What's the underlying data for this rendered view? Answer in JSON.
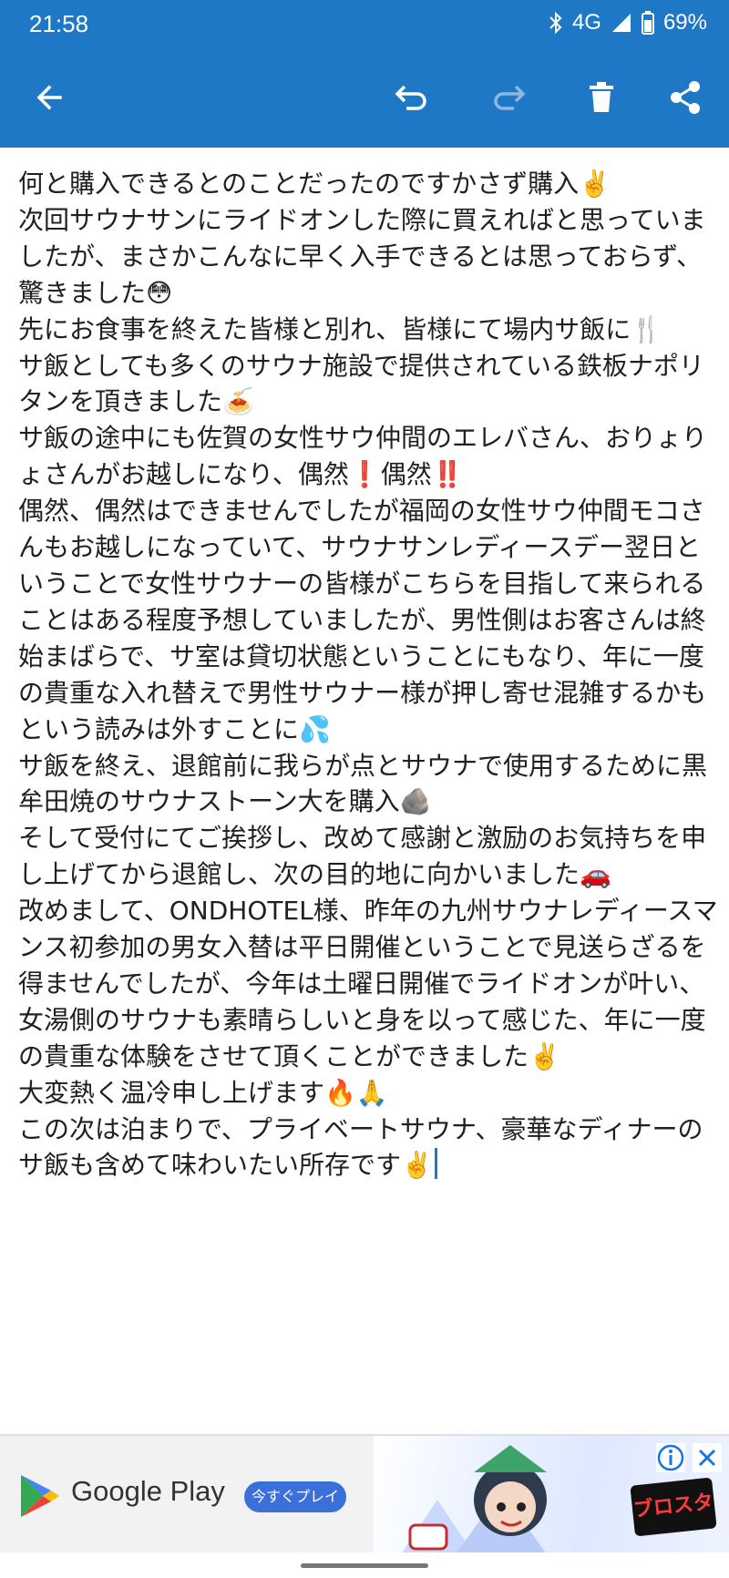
{
  "status_bar": {
    "time": "21:58",
    "network": "4G",
    "battery": "69%",
    "icons": [
      "bluetooth-icon",
      "signal-icon",
      "battery-icon"
    ]
  },
  "toolbar": {
    "icons": [
      "back-arrow-icon",
      "undo-icon",
      "redo-icon",
      "trash-icon",
      "share-icon"
    ]
  },
  "editor": {
    "body": "何と購入できるとのことだったのですかさず購入✌️\n次回サウナサンにライドオンした際に買えればと思っていましたが、まさかこんなに早く入手できるとは思っておらず、驚きました😳\n先にお食事を終えた皆様と別れ、皆様にて場内サ飯に🍴\nサ飯としても多くのサウナ施設で提供されている鉄板ナポリタンを頂きました🍝\nサ飯の途中にも佐賀の女性サウ仲間のエレバさん、おりょりょさんがお越しになり、偶然❗偶然‼️\n偶然、偶然はできませんでしたが福岡の女性サウ仲間モコさんもお越しになっていて、サウナサンレディースデー翌日ということで女性サウナーの皆様がこちらを目指して来られることはある程度予想していましたが、男性側はお客さんは終始まばらで、サ室は貸切状態ということにもなり、年に一度の貴重な入れ替えで男性サウナー様が押し寄せ混雑するかもという読みは外すことに💦\nサ飯を終え、退館前に我らが点とサウナで使用するために黒牟田焼のサウナストーン大を購入🪨\nそして受付にてご挨拶し、改めて感謝と激励のお気持ちを申し上げてから退館し、次の目的地に向かいました🚗\n改めまして、ONDHOTEL様、昨年の九州サウナレディースマンス初参加の男女入替は平日開催ということで見送らざるを得ませんでしたが、今年は土曜日開催でライドオンが叶い、女湯側のサウナも素晴らしいと身を以って感じた、年に一度の貴重な体験をさせて頂くことができました✌️\n大変熱く温冷申し上げます🔥🙏\nこの次は泊まりで、プライベートサウナ、豪華なディナーのサ飯も含めて味わいたい所存です✌️"
  },
  "ad": {
    "brand": "Google Play",
    "cta": "今すぐプレイ",
    "game_logo": "ブロスタ",
    "colors": {
      "cta": "#3b6fd9"
    },
    "icons": [
      "google-play-logo-icon",
      "info-icon",
      "close-icon"
    ]
  },
  "colors": {
    "app_bar": "#1f78c6",
    "text": "#202020",
    "caret": "#1f78c6"
  }
}
